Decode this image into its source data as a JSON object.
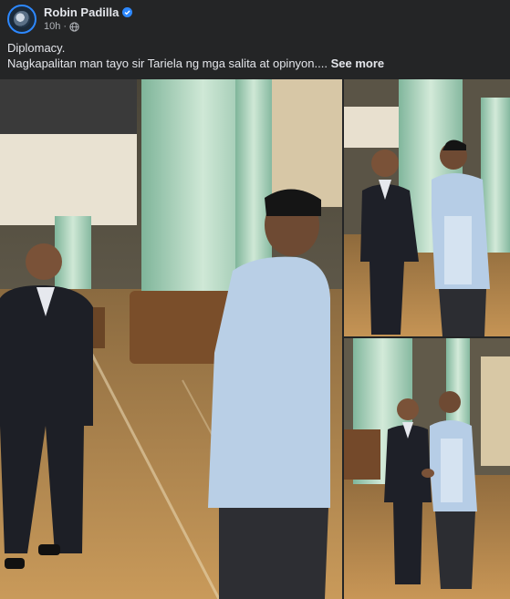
{
  "post": {
    "author": "Robin Padilla",
    "timestamp": "10h",
    "separator": "·",
    "text_line1": "Diplomacy.",
    "text_line2": "Nagkapalitan man tayo sir Tariela ng mga salita at opinyon....",
    "see_more": "See more"
  },
  "colors": {
    "background": "#242526",
    "text_primary": "#e4e6eb",
    "text_secondary": "#b0b3b8",
    "verified_badge": "#2d88ff"
  },
  "icons": {
    "verified": "verified-badge-icon",
    "audience": "globe-icon"
  }
}
